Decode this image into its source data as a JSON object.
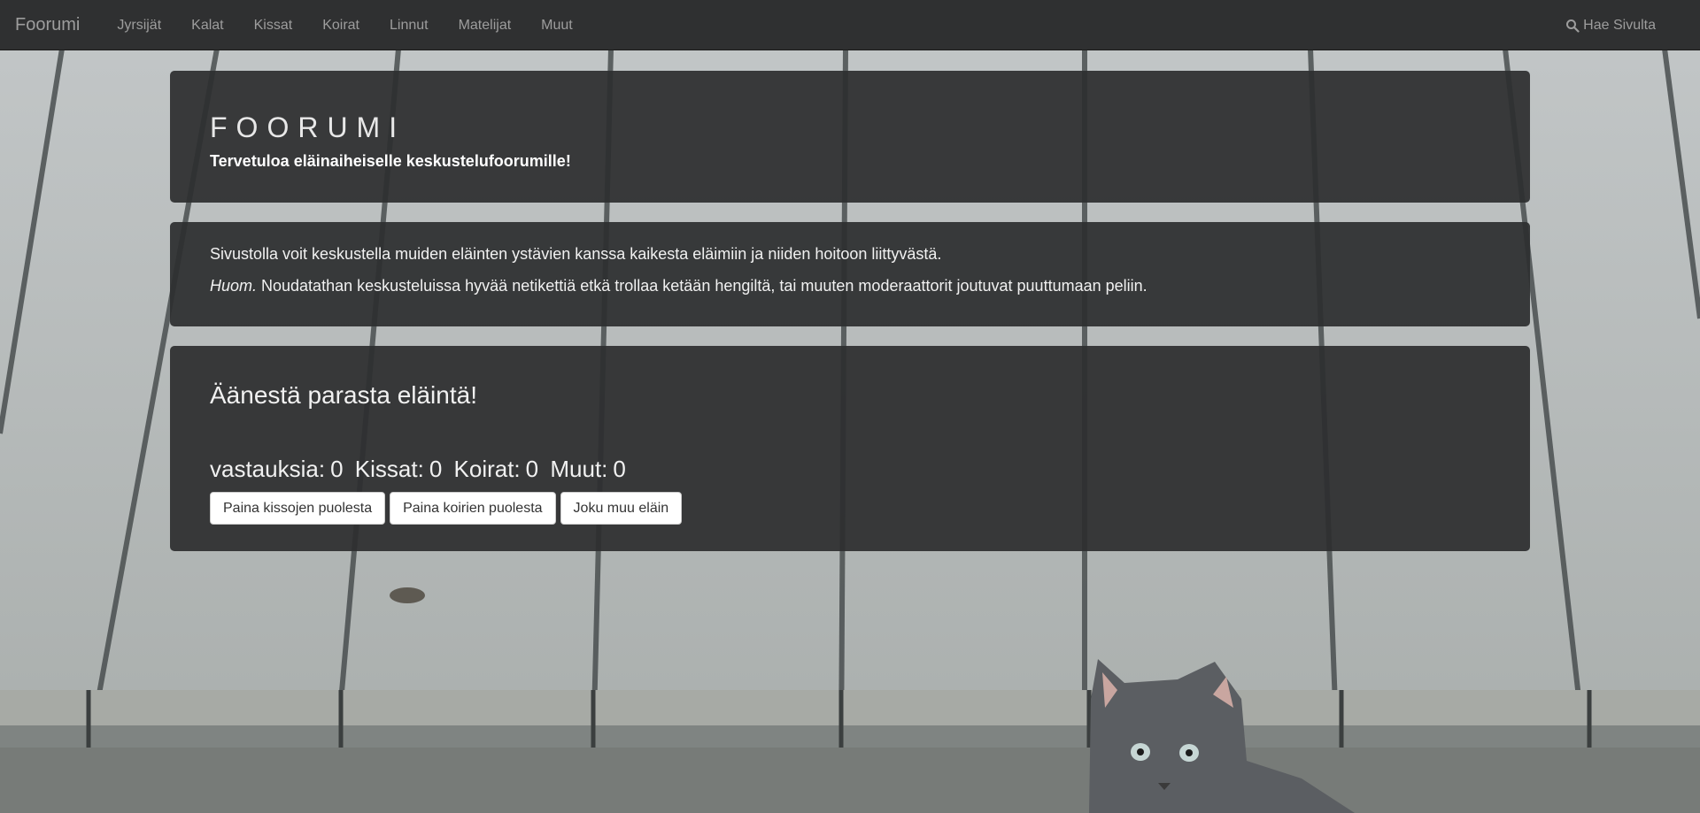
{
  "navbar": {
    "brand": "Foorumi",
    "items": [
      "Jyrsijät",
      "Kalat",
      "Kissat",
      "Koirat",
      "Linnut",
      "Matelijat",
      "Muut"
    ],
    "search_label": "Hae Sivulta"
  },
  "hero": {
    "title": "FOORUMI",
    "subtitle": "Tervetuloa eläinaiheiselle keskustelufoorumille!"
  },
  "info": {
    "line1": "Sivustolla voit keskustella muiden eläinten ystävien kanssa kaikesta eläimiin ja niiden hoitoon liittyvästä.",
    "note_label": "Huom.",
    "line2": " Noudatathan keskusteluissa hyvää netikettiä etkä trollaa ketään hengiltä, tai muuten moderaattorit joutuvat puuttumaan peliin."
  },
  "vote": {
    "title": "Äänestä parasta eläintä!",
    "answers_label": "vastauksia:",
    "answers": "0",
    "cats_label": "Kissat:",
    "cats": "0",
    "dogs_label": "Koirat:",
    "dogs": "0",
    "others_label": "Muut:",
    "others": "0",
    "btn_cats": "Paina kissojen puolesta",
    "btn_dogs": "Paina koirien puolesta",
    "btn_other": "Joku muu eläin"
  },
  "colors": {
    "navbar_bg": "#2f3031",
    "panel_bg": "#2d2e2f",
    "nav_text": "#9d9d9d"
  }
}
